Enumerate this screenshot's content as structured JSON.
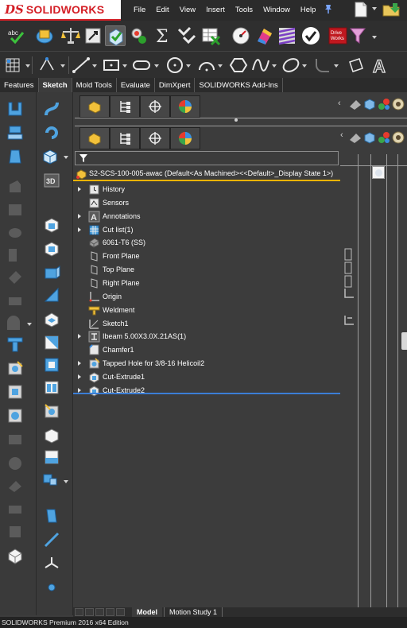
{
  "app": {
    "logo_prefix": "DS",
    "logo_text": "SOLIDWORKS",
    "status_text": "SOLIDWORKS Premium 2016 x64 Edition"
  },
  "menu": [
    "File",
    "Edit",
    "View",
    "Insert",
    "Tools",
    "Window",
    "Help"
  ],
  "tabs": [
    "Features",
    "Sketch",
    "Mold Tools",
    "Evaluate",
    "DimXpert",
    "SOLIDWORKS Add-Ins"
  ],
  "active_tab": "Sketch",
  "feature_tree": {
    "root": "S2-SCS-100-005-awac  (Default<As Machined><<Default>_Display State 1>)",
    "items": [
      {
        "label": "History",
        "icon": "history-icon",
        "expandable": true
      },
      {
        "label": "Sensors",
        "icon": "sensors-icon",
        "expandable": false
      },
      {
        "label": "Annotations",
        "icon": "annotations-icon",
        "expandable": true
      },
      {
        "label": "Cut list(1)",
        "icon": "cut-list-icon",
        "expandable": true
      },
      {
        "label": "6061-T6 (SS)",
        "icon": "material-icon",
        "expandable": false
      },
      {
        "label": "Front Plane",
        "icon": "plane-icon",
        "expandable": false
      },
      {
        "label": "Top Plane",
        "icon": "plane-icon",
        "expandable": false
      },
      {
        "label": "Right Plane",
        "icon": "plane-icon",
        "expandable": false
      },
      {
        "label": "Origin",
        "icon": "origin-icon",
        "expandable": false
      },
      {
        "label": "Weldment",
        "icon": "weldment-icon",
        "expandable": false
      },
      {
        "label": "Sketch1",
        "icon": "sketch-icon",
        "expandable": false
      },
      {
        "label": "Ibeam 5.00X3.0X.21AS(1)",
        "icon": "structural-member-icon",
        "expandable": true
      },
      {
        "label": "Chamfer1",
        "icon": "chamfer-icon",
        "expandable": false
      },
      {
        "label": "Tapped Hole for 3/8-16 Helicoil2",
        "icon": "hole-wizard-icon",
        "expandable": true
      },
      {
        "label": "Cut-Extrude1",
        "icon": "cut-extrude-icon",
        "expandable": true
      },
      {
        "label": "Cut-Extrude2",
        "icon": "cut-extrude-icon",
        "expandable": true
      }
    ]
  },
  "bottom_tabs": [
    "Model",
    "Motion Study 1"
  ],
  "colors": {
    "background": "#3c3c3c",
    "brand_red": "#d41f26",
    "root_underline": "#f0b300",
    "rollback_bar": "#3b7ed6"
  }
}
